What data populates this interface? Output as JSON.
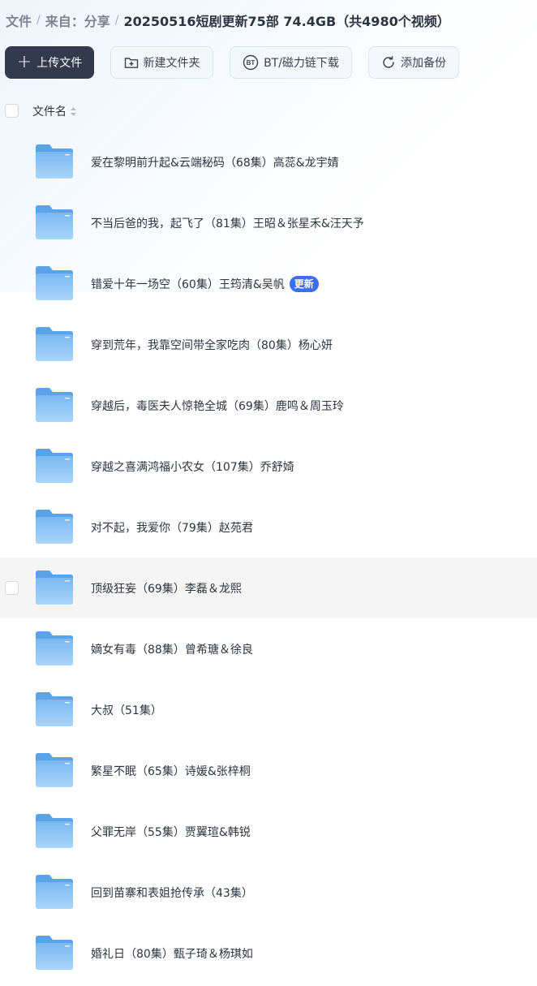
{
  "breadcrumb": {
    "items": [
      "文件",
      "来自：分享"
    ],
    "separator": "/",
    "current": "20250516短剧更新75部 74.4GB（共4980个视频）"
  },
  "toolbar": {
    "upload_label": "上传文件",
    "new_folder_label": "新建文件夹",
    "bt_label": "BT/磁力链下载",
    "backup_label": "添加备份"
  },
  "list": {
    "column_name": "文件名",
    "rows": [
      {
        "name": "爱在黎明前升起&云端秘码（68集）高蕊&龙宇婧",
        "badge": ""
      },
      {
        "name": "不当后爸的我，起飞了（81集）王昭＆张星禾&汪天予",
        "badge": ""
      },
      {
        "name": "错爱十年一场空（60集）王筠清&吴帆",
        "badge": "更新"
      },
      {
        "name": "穿到荒年，我靠空间带全家吃肉（80集）杨心妍",
        "badge": ""
      },
      {
        "name": "穿越后，毒医夫人惊艳全城（69集）鹿鸣＆周玉玲",
        "badge": ""
      },
      {
        "name": "穿越之喜满鸿福小农女（107集）乔舒婍",
        "badge": ""
      },
      {
        "name": "对不起，我爱你（79集）赵苑君",
        "badge": ""
      },
      {
        "name": "顶级狂妄（69集）李磊＆龙熙",
        "badge": ""
      },
      {
        "name": "嫡女有毒（88集）曾希瑭＆徐良",
        "badge": ""
      },
      {
        "name": "大叔（51集）",
        "badge": ""
      },
      {
        "name": "繁星不眠（65集）诗媛&张梓桐",
        "badge": ""
      },
      {
        "name": "父罪无岸（55集）贾翼瑄&韩锐",
        "badge": ""
      },
      {
        "name": "回到苗寨和表姐抢传承（43集）",
        "badge": ""
      },
      {
        "name": "婚礼日（80集）甄子琦＆杨琪如",
        "badge": ""
      }
    ],
    "hovered_index": 7
  },
  "colors": {
    "primary_button": "#333a4d",
    "badge": "#3d6df2",
    "folder": "#6fb1ee"
  },
  "icons": {
    "upload": "plus-icon",
    "new_folder": "folder-plus-icon",
    "bt": "bt-icon",
    "backup": "refresh-icon",
    "sort": "sort-icon",
    "folder": "folder-icon"
  }
}
